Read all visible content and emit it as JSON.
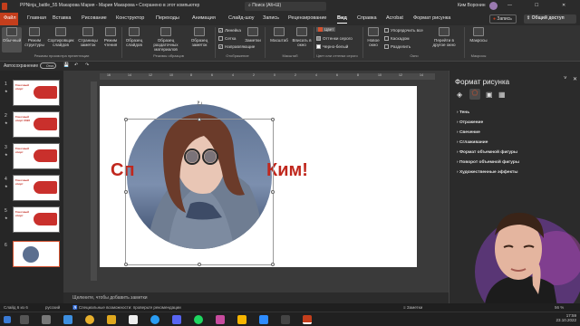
{
  "titlebar": {
    "title": "PPNinja_battle_55 Макарова Мария - Мария Макарова • Сохранено в этот компьютер",
    "search": "Поиск (Alt+Ш)",
    "user": "Ким Воронин"
  },
  "tabs": [
    "Файл",
    "Главная",
    "Вставка",
    "Рисование",
    "Конструктор",
    "Переходы",
    "Анимация",
    "Слайд-шоу",
    "Запись",
    "Рецензирование",
    "Вид",
    "Справка",
    "Acrobat",
    "Формат рисунка"
  ],
  "active_tab": "Вид",
  "share": {
    "record": "Запись",
    "share": "Общий доступ"
  },
  "ribbon": {
    "views": [
      "Обычный",
      "Режим структуры",
      "Сортировщик слайдов",
      "Страницы заметок",
      "Режим чтения"
    ],
    "masters": [
      "Образец слайдов",
      "Образец раздаточных материалов",
      "Образец заметок"
    ],
    "show": [
      "Линейка",
      "Сетка",
      "Направляющие"
    ],
    "show_checked": [
      true,
      false,
      true
    ],
    "notes": "Заметки",
    "zoom": [
      "Масштаб",
      "Вписать в окно"
    ],
    "color": [
      "Цвет",
      "Оттенки серого",
      "Черно-белый"
    ],
    "new_window": "Новое окно",
    "window": [
      "Упорядочить все",
      "Каскадом",
      "Разделить"
    ],
    "switch": "Перейти в другое окно",
    "macros": "Макросы",
    "groups": [
      "Режимы просмотра презентации",
      "Режимы образцов",
      "Отображение",
      "Масштаб",
      "Цвет или оттенки серого",
      "Окно",
      "Макросы"
    ]
  },
  "qat": {
    "autosave": "Автосохранение",
    "toggle": "Откл."
  },
  "slides": [
    {
      "num": "1",
      "title": "Гоночный спорт"
    },
    {
      "num": "2",
      "title": "Гоночный спорт 2022"
    },
    {
      "num": "3",
      "title": "Гоночный спорт"
    },
    {
      "num": "4",
      "title": "Гоночный спорт"
    },
    {
      "num": "5",
      "title": "Гоночный спорт"
    },
    {
      "num": "6",
      "title": ""
    }
  ],
  "slide": {
    "headline_left": "Сп",
    "headline_right": "Ким!"
  },
  "notes_placeholder": "Щелкните, чтобы добавить заметки",
  "panel": {
    "title": "Формат рисунка",
    "sections": [
      "Тень",
      "Отражение",
      "Свечение",
      "Сглаживание",
      "Формат объемной фигуры",
      "Поворот объемной фигуры",
      "Художественные эффекты"
    ]
  },
  "status": {
    "slide": "Слайд 6 из 6",
    "lang": "русский",
    "accessibility": "Специальные возможности: проверьте рекомендации",
    "notes": "Заметки",
    "zoom": "56 %"
  },
  "taskbar": {
    "time": "17:59",
    "date": "23.10.2022"
  },
  "colors": {
    "accent": "#c43e1c",
    "headline": "#c0271d",
    "panel": "#2b2b2b"
  }
}
